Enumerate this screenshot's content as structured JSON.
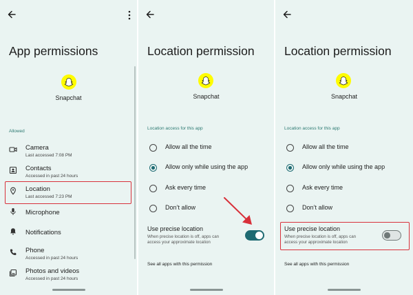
{
  "screen1": {
    "title": "App permissions",
    "app_name": "Snapchat",
    "section_label": "Allowed",
    "permissions": [
      {
        "name": "Camera",
        "sub": "Last accessed 7:08 PM",
        "icon": "camera-icon"
      },
      {
        "name": "Contacts",
        "sub": "Accessed in past 24 hours",
        "icon": "contacts-icon"
      },
      {
        "name": "Location",
        "sub": "Last accessed 7:23 PM",
        "icon": "location-pin-icon"
      },
      {
        "name": "Microphone",
        "sub": "",
        "icon": "microphone-icon"
      },
      {
        "name": "Notifications",
        "sub": "",
        "icon": "bell-icon"
      },
      {
        "name": "Phone",
        "sub": "Accessed in past 24 hours",
        "icon": "phone-icon"
      },
      {
        "name": "Photos and videos",
        "sub": "Accessed in past 24 hours",
        "icon": "photos-icon"
      }
    ]
  },
  "screen2": {
    "title": "Location permission",
    "app_name": "Snapchat",
    "section_label": "Location access for this app",
    "options": [
      "Allow all the time",
      "Allow only while using the app",
      "Ask every time",
      "Don’t allow"
    ],
    "selected_option": "Allow only while using the app",
    "precise_title": "Use precise location",
    "precise_desc": "When precise location is off, apps can access your approximate location",
    "precise_enabled": true,
    "see_all": "See all apps with this permission"
  },
  "screen3": {
    "title": "Location permission",
    "app_name": "Snapchat",
    "section_label": "Location access for this app",
    "options": [
      "Allow all the time",
      "Allow only while using the app",
      "Ask every time",
      "Don’t allow"
    ],
    "selected_option": "Allow only while using the app",
    "precise_title": "Use precise location",
    "precise_desc": "When precise location is off, apps can access your approximate location",
    "precise_enabled": false,
    "see_all": "See all apps with this permission"
  },
  "colors": {
    "panel_bg": "#eaf4f2",
    "accent": "#1e6a72",
    "highlight": "#d8303a",
    "snapchat_yellow": "#fffc00"
  }
}
